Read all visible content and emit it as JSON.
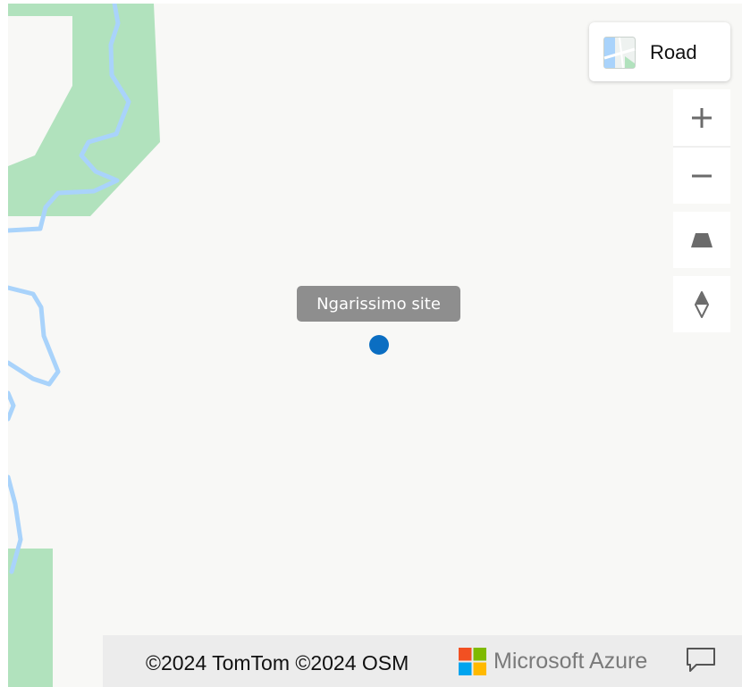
{
  "map": {
    "style_label": "Road",
    "marker_label": "Ngarissimo site",
    "copyright": "©2024 TomTom ©2024 OSM",
    "brand": "Microsoft Azure"
  },
  "colors": {
    "land": "#f8f8f6",
    "forest": "#b1e2bd",
    "water": "#a9d3fb",
    "marker": "#0b6ec2",
    "label_bg": "#8e8e8e",
    "attribution_bg": "#ececec"
  },
  "icons": {
    "zoom_in": "plus-icon",
    "zoom_out": "minus-icon",
    "pitch": "trapezoid-icon",
    "compass": "compass-icon",
    "feedback": "speech-bubble-icon",
    "brand": "microsoft-logo-icon"
  }
}
